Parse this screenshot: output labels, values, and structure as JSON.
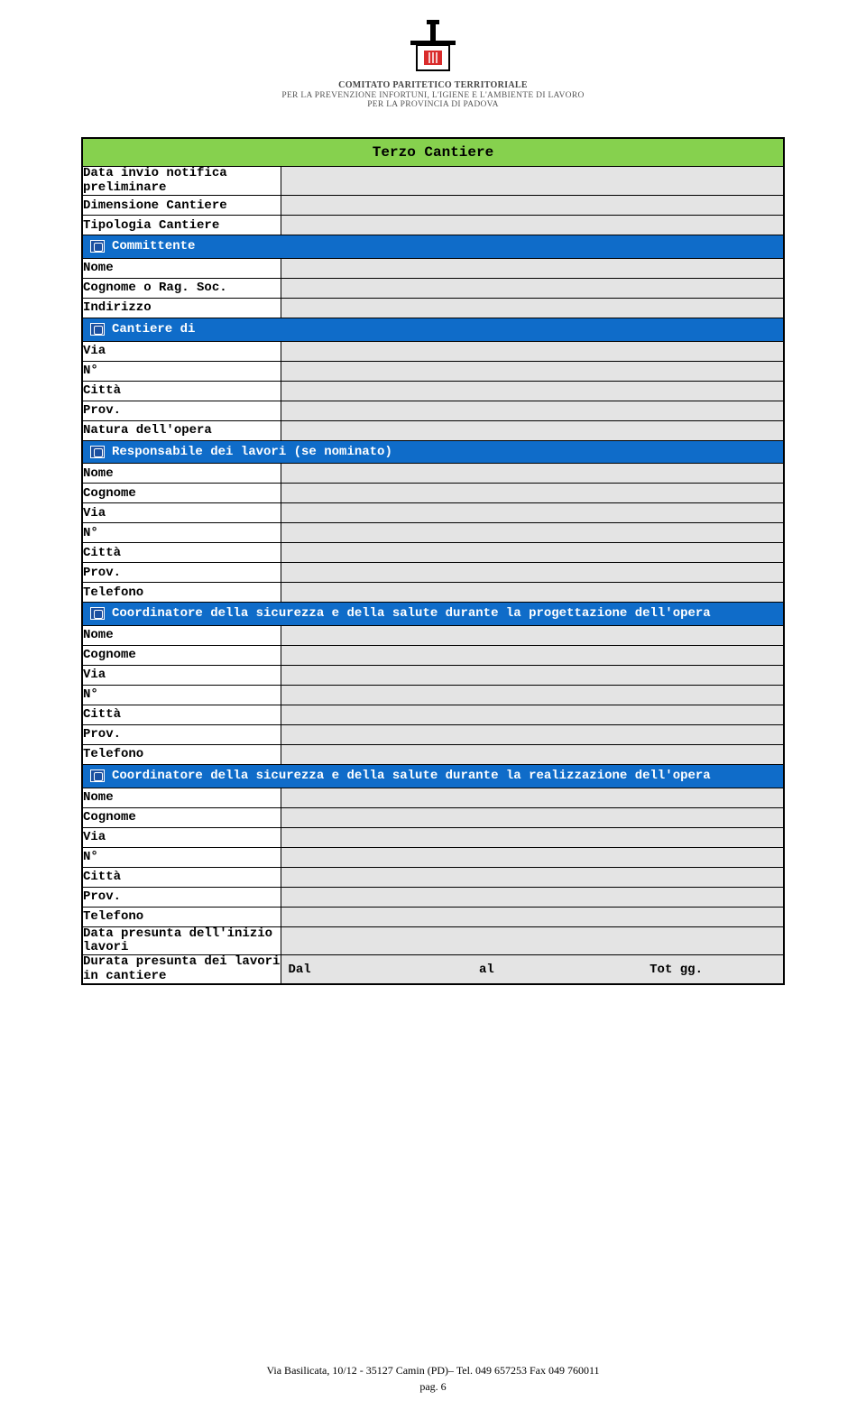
{
  "header": {
    "org_line1": "COMITATO PARITETICO TERRITORIALE",
    "org_line2": "PER LA PREVENZIONE INFORTUNI, L'IGIENE E L'AMBIENTE DI LAVORO",
    "org_line3": "PER LA PROVINCIA DI PADOVA"
  },
  "form": {
    "title": "Terzo Cantiere",
    "rows": {
      "data_invio": "Data invio notifica preliminare",
      "dimensione": "Dimensione Cantiere",
      "tipologia": "Tipologia Cantiere"
    },
    "sections": {
      "committente": "Committente",
      "cantiere_di": "Cantiere di",
      "responsabile": "Responsabile dei lavori (se nominato)",
      "coord_prog": "Coordinatore della sicurezza e della salute durante la progettazione dell'opera",
      "coord_real": "Coordinatore della sicurezza e della salute durante la realizzazione dell'opera"
    },
    "labels": {
      "nome": "Nome",
      "cognome_rag": "Cognome o Rag. Soc.",
      "cognome": "Cognome",
      "indirizzo": "Indirizzo",
      "via": "Via",
      "n": "N°",
      "citta": "Città",
      "prov": "Prov.",
      "natura": "Natura dell'opera",
      "telefono": "Telefono",
      "data_presunta": "Data presunta dell'inizio lavori",
      "durata_presunta": "Durata presunta dei lavori in cantiere"
    },
    "durata": {
      "dal": "Dal",
      "al": "al",
      "tot": "Tot gg."
    }
  },
  "footer": {
    "address": "Via Basilicata, 10/12 - 35127 Camin (PD)– Tel. 049 657253 Fax 049 760011",
    "page": "pag.  6"
  }
}
